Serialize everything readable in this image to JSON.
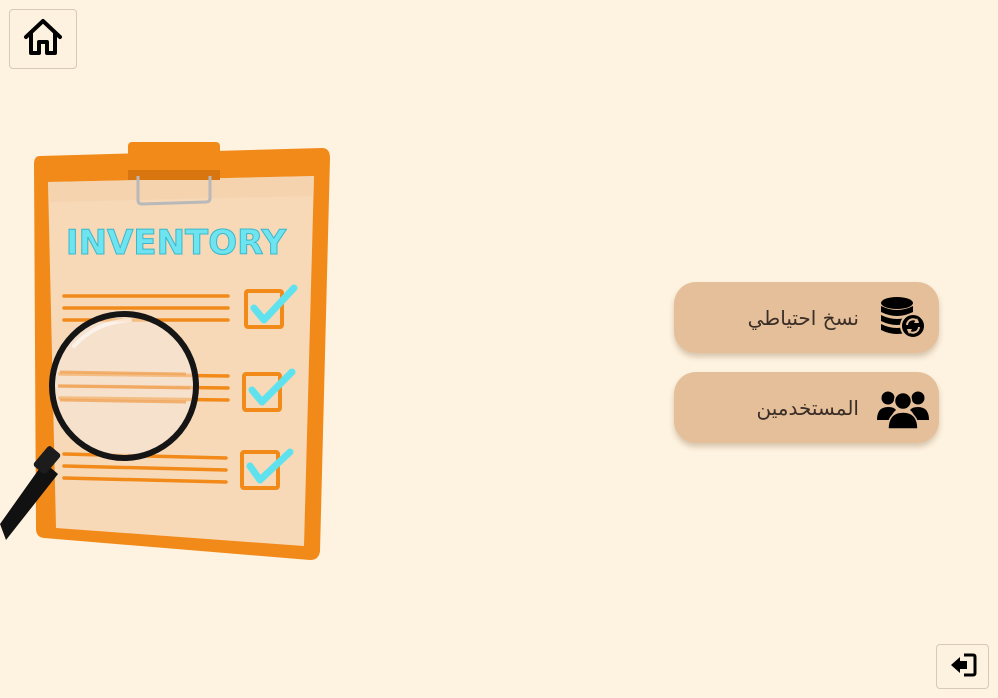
{
  "toolbar": {
    "home_icon": "home-icon",
    "logout_icon": "logout-icon"
  },
  "illustration": {
    "clipboard_title": "INVENTORY",
    "accent_color": "#f39422",
    "check_color": "#5fe2ee"
  },
  "menu": {
    "items": [
      {
        "label": "نسخ احتياطي",
        "icon": "database-sync-icon"
      },
      {
        "label": "المستخدمين",
        "icon": "users-icon"
      }
    ],
    "button_color": "#e4bf9a"
  },
  "colors": {
    "background": "#fef3e1"
  }
}
